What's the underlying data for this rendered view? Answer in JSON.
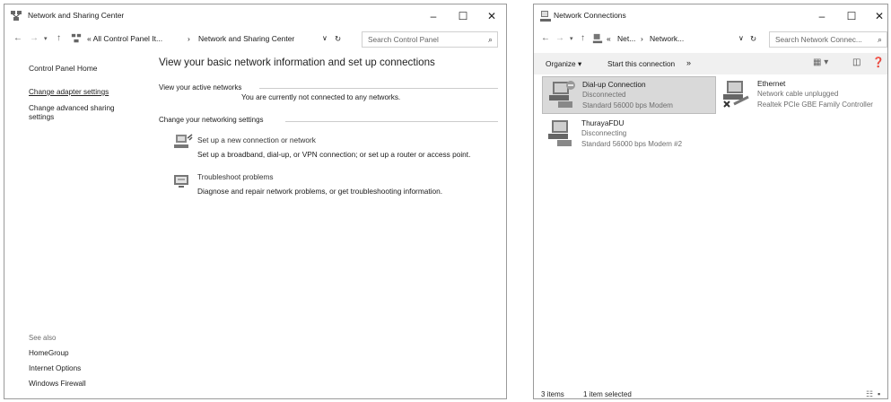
{
  "win1": {
    "title": "Network and Sharing Center",
    "breadcrumb": [
      "« All Control Panel It...",
      "›",
      "Network and Sharing Center"
    ],
    "search_placeholder": "Search Control Panel",
    "left": {
      "home": "Control Panel Home",
      "links": [
        "Change adapter settings",
        "Change advanced sharing\nsettings"
      ],
      "see_also_label": "See also",
      "see_also": [
        "HomeGroup",
        "Internet Options",
        "Windows Firewall"
      ]
    },
    "main": {
      "heading": "View your basic network information and set up connections",
      "active_label": "View your active networks",
      "active_status": "You are currently not connected to any networks.",
      "change_label": "Change your networking settings",
      "tasks": [
        {
          "title": "Set up a new connection or network",
          "desc": "Set up a broadband, dial-up, or VPN connection; or set up a router or access point."
        },
        {
          "title": "Troubleshoot problems",
          "desc": "Diagnose and repair network problems, or get troubleshooting information."
        }
      ]
    }
  },
  "win2": {
    "title": "Network Connections",
    "breadcrumb": [
      "«",
      "Net...",
      "›",
      "Network..."
    ],
    "search_placeholder": "Search Network Connec...",
    "toolbar": {
      "organize": "Organize ▾",
      "start": "Start this connection",
      "more": "»"
    },
    "items": [
      {
        "name": "Dial-up Connection",
        "status": "Disconnected",
        "device": "Standard 56000 bps Modem",
        "selected": true
      },
      {
        "name": "Ethernet",
        "status": "Network cable unplugged",
        "device": "Realtek PCIe GBE Family Controller",
        "selected": false
      },
      {
        "name": "ThurayaFDU",
        "status": "Disconnecting",
        "device": "Standard 56000 bps Modem #2",
        "selected": false
      }
    ],
    "statusbar": {
      "count": "3 items",
      "selected": "1 item selected"
    }
  },
  "colors": {
    "link": "#1a1a1a",
    "selected_bg": "#d9d9d9",
    "grey_text": "#6d6d6d"
  },
  "icons": [
    "network-center-icon",
    "minimize-icon",
    "maximize-icon",
    "close-icon",
    "back-arrow-icon",
    "forward-arrow-icon",
    "up-arrow-icon",
    "refresh-icon",
    "search-icon",
    "modem-icon",
    "ethernet-icon",
    "view-icon",
    "help-icon"
  ]
}
